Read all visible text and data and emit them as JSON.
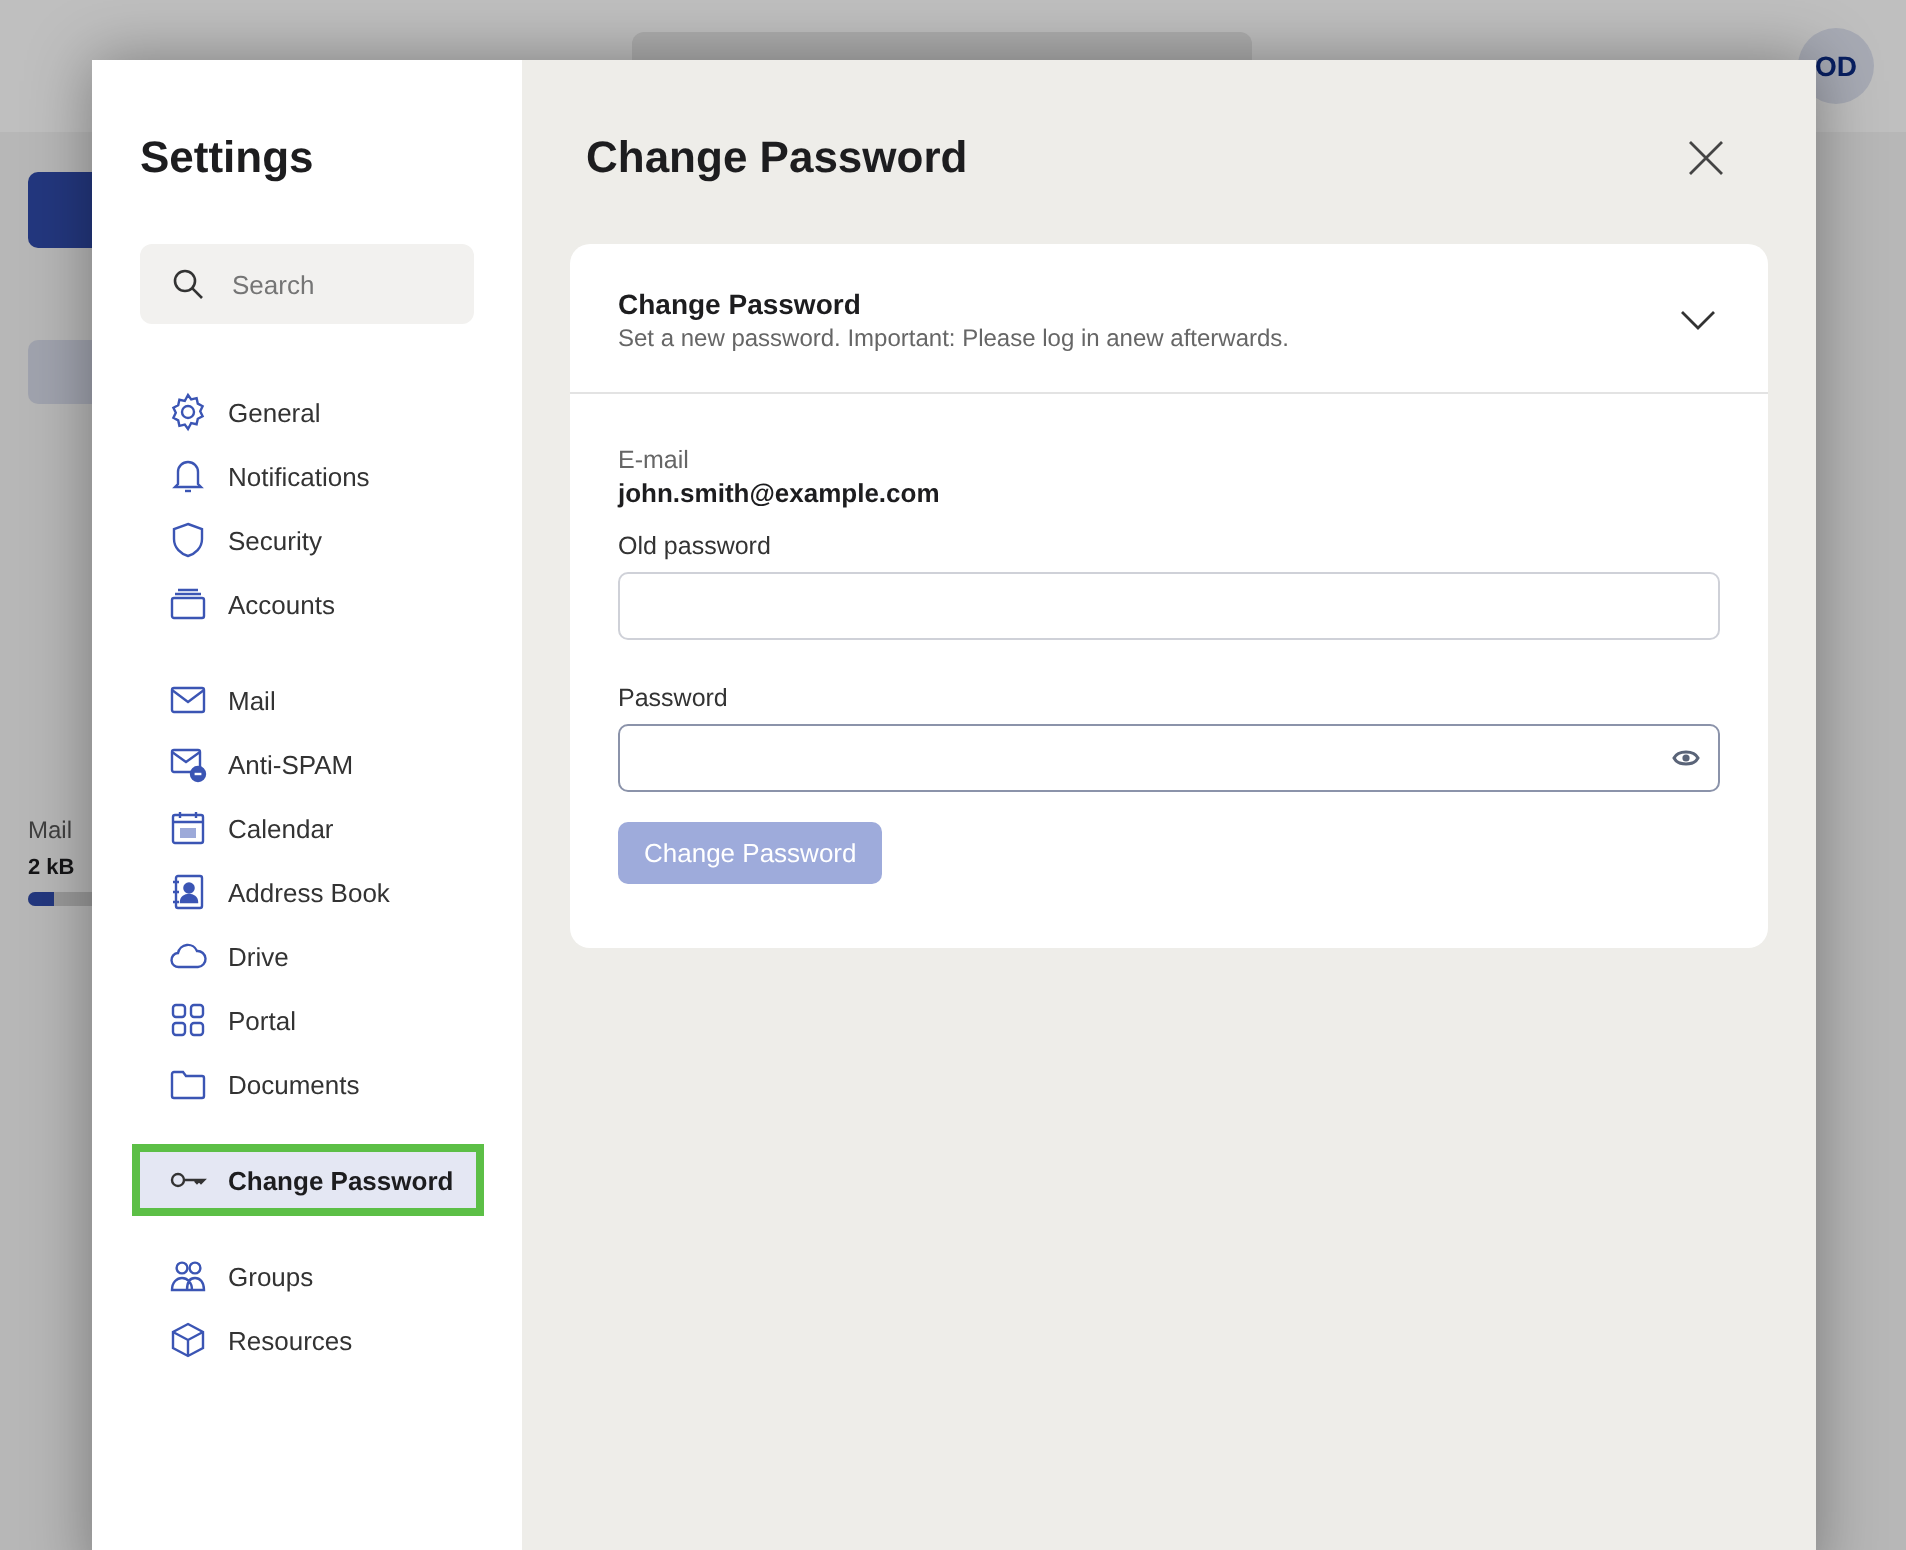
{
  "background": {
    "avatar": "OD",
    "quota": {
      "label": "Mail",
      "value": "2 kB",
      "level": 0.1
    }
  },
  "settings": {
    "title": "Settings",
    "search": {
      "placeholder": "Search"
    },
    "nav_groups": [
      [
        {
          "label": "General",
          "selected": false
        },
        {
          "label": "Notifications",
          "selected": false
        },
        {
          "label": "Security",
          "selected": false
        },
        {
          "label": "Accounts",
          "selected": false
        }
      ],
      [
        {
          "label": "Mail",
          "selected": false
        },
        {
          "label": "Anti-SPAM",
          "selected": false
        },
        {
          "label": "Calendar",
          "selected": false
        },
        {
          "label": "Address Book",
          "selected": false
        },
        {
          "label": "Drive",
          "selected": false
        },
        {
          "label": "Portal",
          "selected": false
        },
        {
          "label": "Documents",
          "selected": false
        }
      ],
      [
        {
          "label": "Change Password",
          "selected": true
        }
      ],
      [
        {
          "label": "Groups",
          "selected": false
        },
        {
          "label": "Resources",
          "selected": false
        }
      ]
    ]
  },
  "page": {
    "title": "Change Password",
    "card": {
      "title": "Change Password",
      "subtitle": "Set a new password. Important: Please log in anew afterwards.",
      "expanded": true,
      "email_label": "E-mail",
      "email": "john.smith@example.com",
      "old_password_label": "Old password",
      "password_label": "Password",
      "submit": {
        "label": "Change Password",
        "disabled": true
      }
    }
  }
}
